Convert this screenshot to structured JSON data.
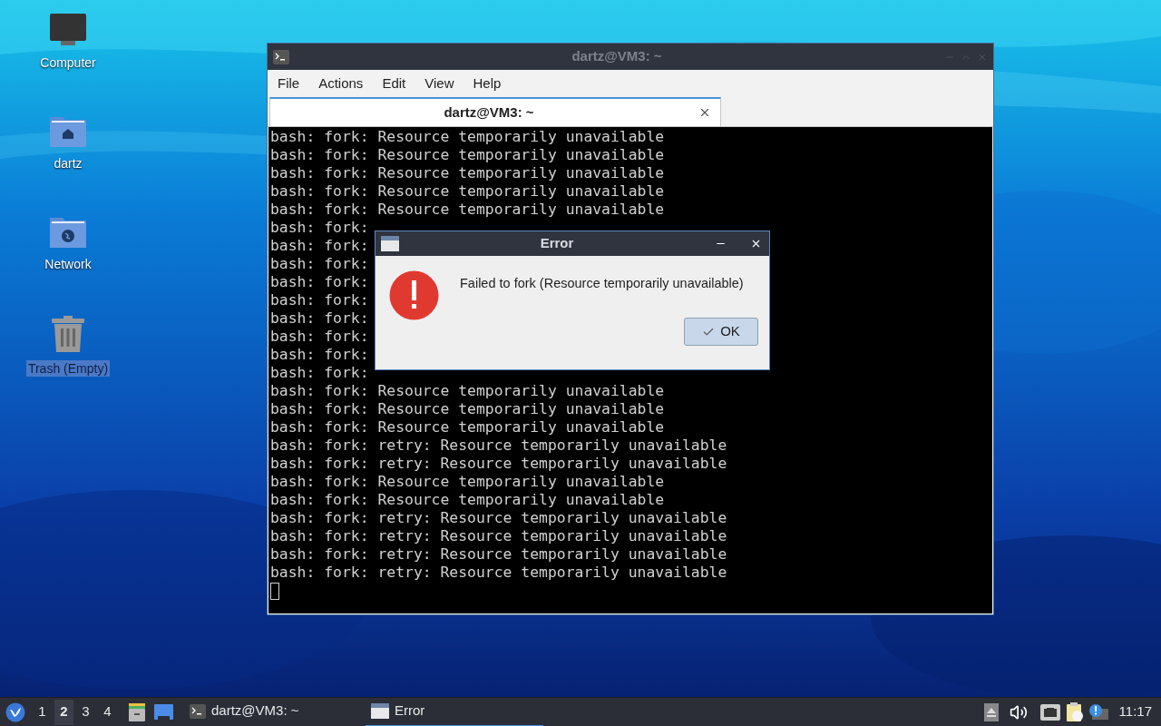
{
  "desktop_icons": [
    {
      "kind": "computer",
      "label": "Computer",
      "selected": false
    },
    {
      "kind": "home",
      "label": "dartz",
      "selected": false
    },
    {
      "kind": "network",
      "label": "Network",
      "selected": false
    },
    {
      "kind": "trash",
      "label": "Trash (Empty)",
      "selected": true
    }
  ],
  "terminal": {
    "title": "dartz@VM3: ~",
    "menu": [
      "File",
      "Actions",
      "Edit",
      "View",
      "Help"
    ],
    "tab": {
      "label": "dartz@VM3: ~",
      "selected": true
    },
    "lines": [
      "bash: fork: Resource temporarily unavailable",
      "bash: fork: Resource temporarily unavailable",
      "bash: fork: Resource temporarily unavailable",
      "bash: fork: Resource temporarily unavailable",
      "bash: fork: Resource temporarily unavailable",
      "bash: fork:",
      "bash: fork:",
      "bash: fork:",
      "bash: fork:",
      "bash: fork:",
      "bash: fork:",
      "bash: fork:",
      "bash: fork:",
      "bash: fork:",
      "bash: fork: Resource temporarily unavailable",
      "bash: fork: Resource temporarily unavailable",
      "bash: fork: Resource temporarily unavailable",
      "bash: fork: retry: Resource temporarily unavailable",
      "bash: fork: retry: Resource temporarily unavailable",
      "bash: fork: Resource temporarily unavailable",
      "bash: fork: Resource temporarily unavailable",
      "bash: fork: retry: Resource temporarily unavailable",
      "bash: fork: retry: Resource temporarily unavailable",
      "bash: fork: retry: Resource temporarily unavailable",
      "bash: fork: retry: Resource temporarily unavailable"
    ]
  },
  "dialog": {
    "title": "Error",
    "message": "Failed to fork (Resource temporarily unavailable)",
    "button": "OK"
  },
  "taskbar": {
    "workspaces": [
      {
        "label": "1",
        "selected": false
      },
      {
        "label": "2",
        "selected": true
      },
      {
        "label": "3",
        "selected": false
      },
      {
        "label": "4",
        "selected": false
      }
    ],
    "tasks": [
      {
        "kind": "terminal",
        "label": "dartz@VM3: ~",
        "selected": false
      },
      {
        "kind": "window",
        "label": "Error",
        "selected": true
      }
    ],
    "clock": "11:17"
  }
}
